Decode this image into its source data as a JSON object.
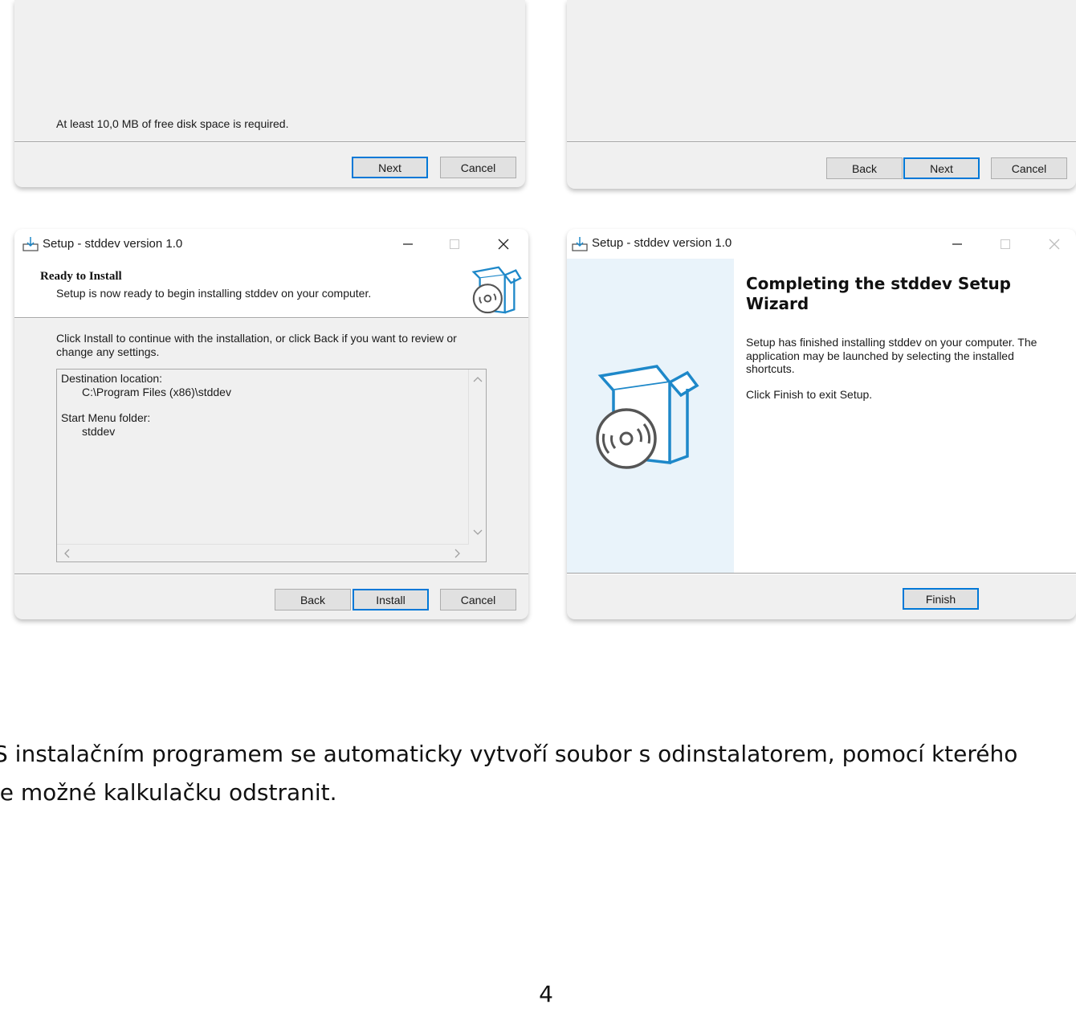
{
  "window1": {
    "disk_space_text": "At least 10,0 MB of free disk space is required.",
    "next_label": "Next",
    "cancel_label": "Cancel"
  },
  "window2": {
    "back_label": "Back",
    "next_label": "Next",
    "cancel_label": "Cancel"
  },
  "window3": {
    "title": "Setup - stddev version 1.0",
    "heading": "Ready to Install",
    "subheading": "Setup is now ready to begin installing stddev on your computer.",
    "instruction": "Click Install to continue with the installation, or click Back if you want to review or change any settings.",
    "memo": {
      "dest_label": "Destination location:",
      "dest_value": "C:\\Program Files (x86)\\stddev",
      "start_menu_label": "Start Menu folder:",
      "start_menu_value": "stddev"
    },
    "back_label": "Back",
    "install_label": "Install",
    "cancel_label": "Cancel"
  },
  "window4": {
    "title": "Setup - stddev version 1.0",
    "heading": "Completing the stddev Setup Wizard",
    "finished_text": "Setup has finished installing stddev on your computer. The application may be launched by selecting the installed shortcuts.",
    "exit_text": "Click Finish to exit Setup.",
    "finish_label": "Finish"
  },
  "page": {
    "caption_line1": "S instalačním programem se automaticky vytvoří soubor s odinstalatorem, pomocí kterého",
    "caption_line2": "je možné kalkulačku odstranit.",
    "page_number": "4"
  },
  "colors": {
    "accent": "#0078d7",
    "icon_blue": "#1e88c9",
    "sidebar": "#e9f3fa"
  }
}
